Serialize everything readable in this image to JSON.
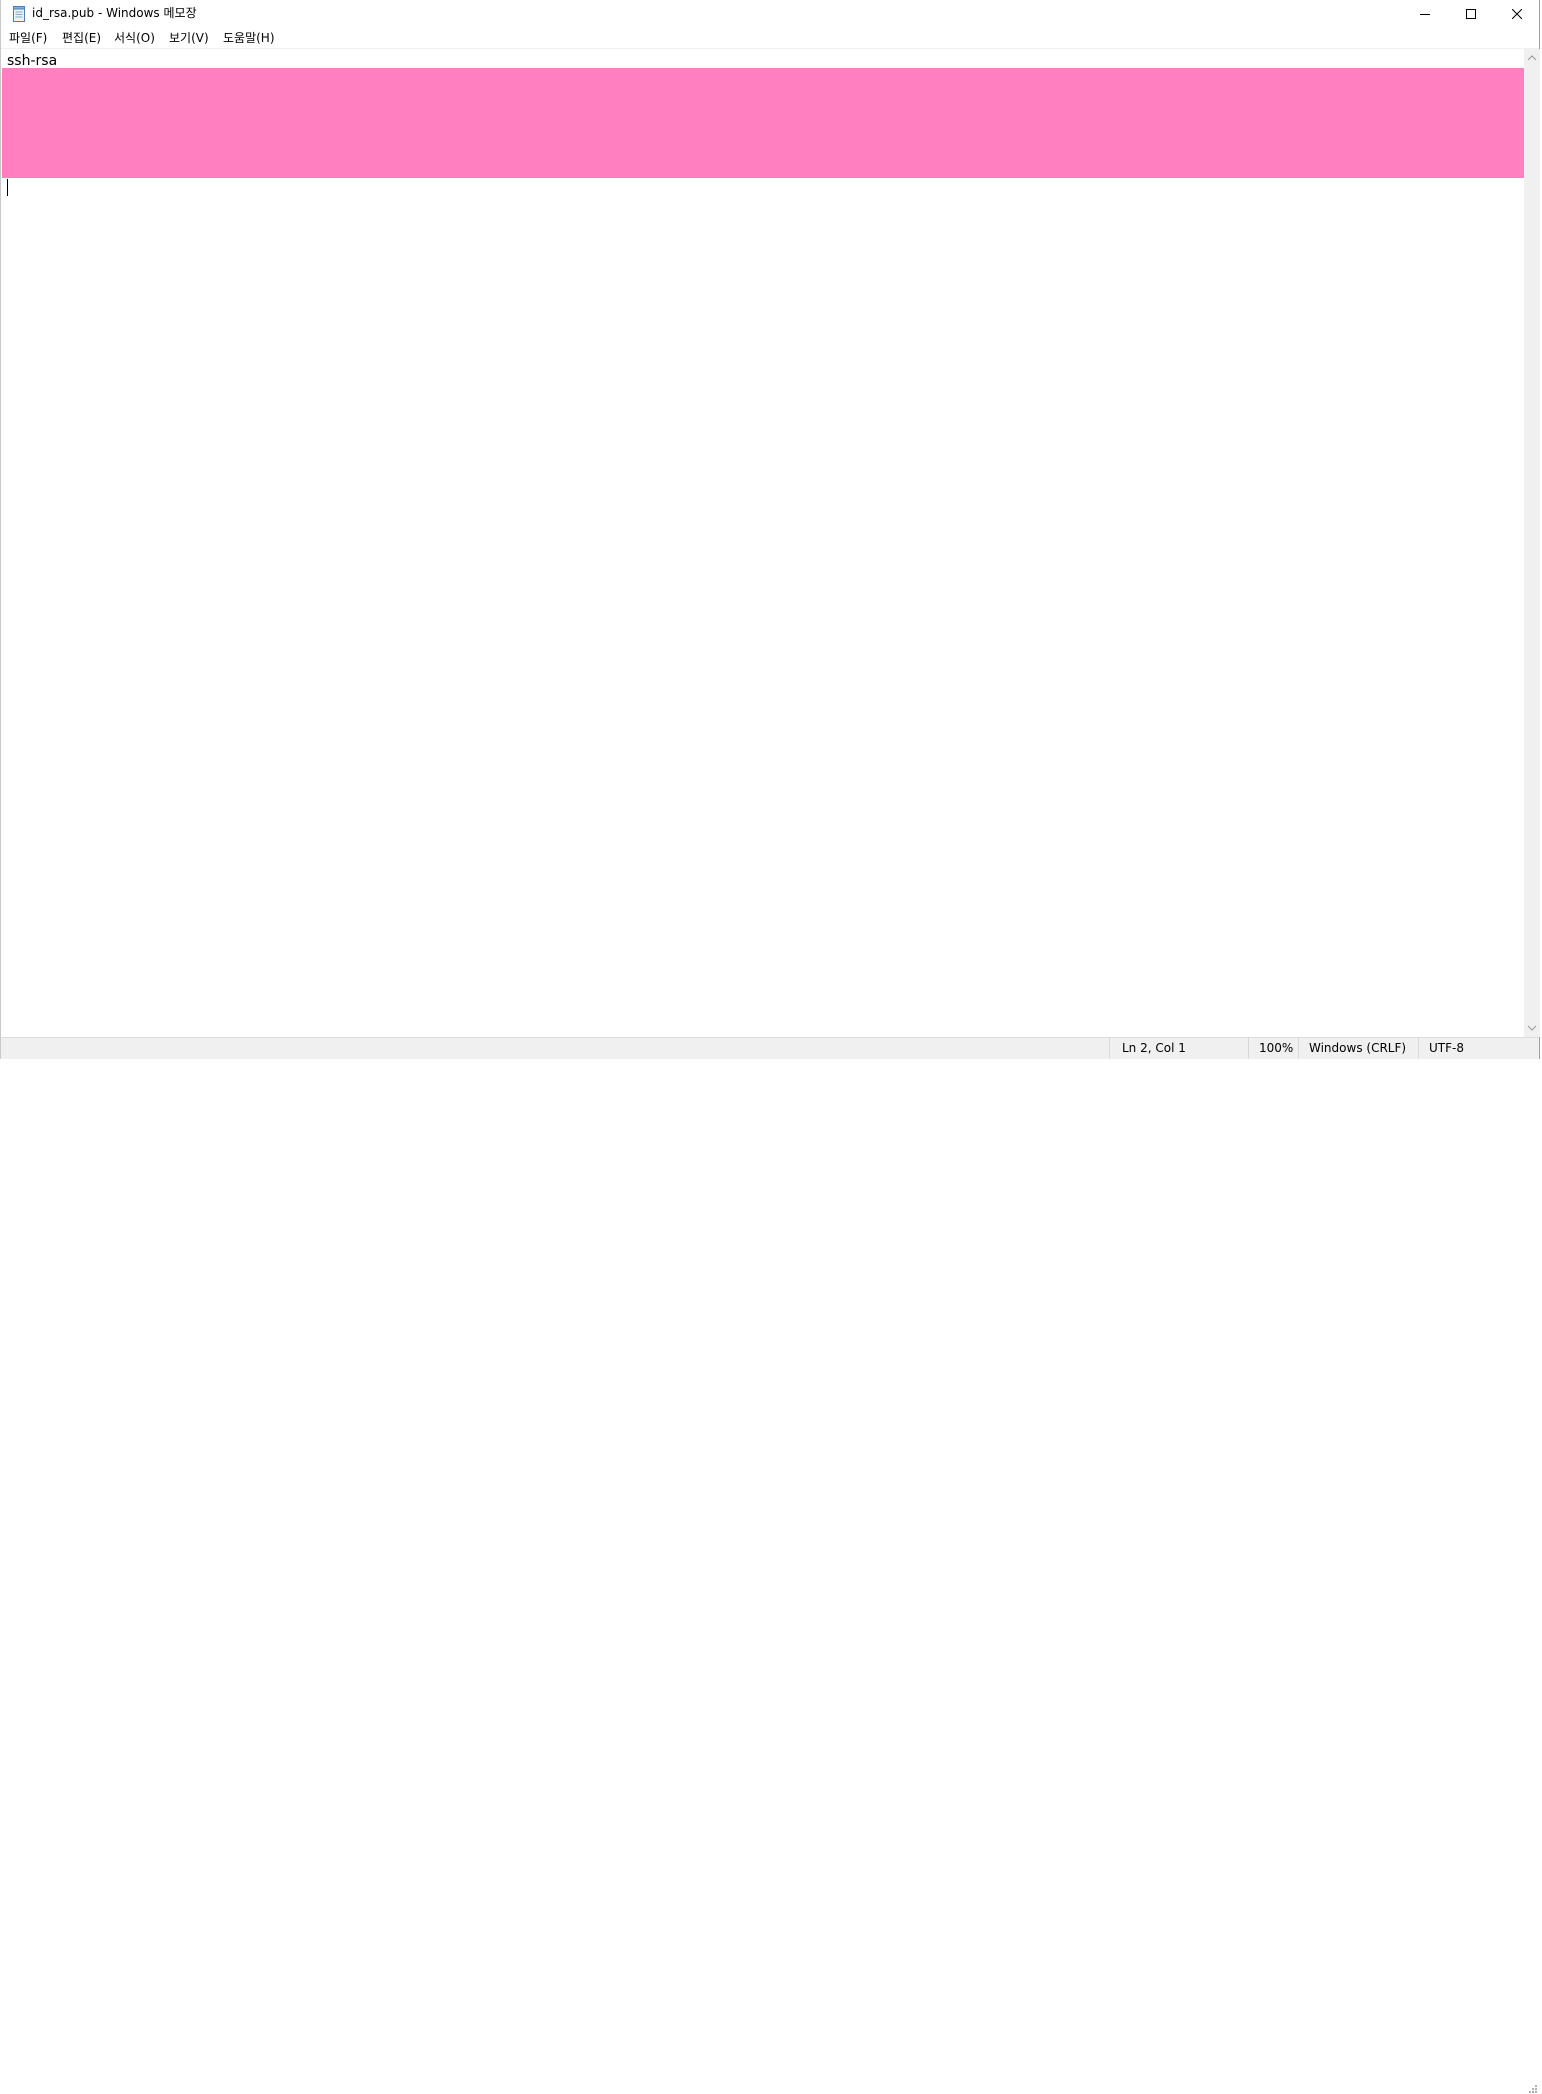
{
  "window": {
    "title": "id_rsa.pub - Windows 메모장",
    "icon": "notepad-icon"
  },
  "menu": {
    "items": [
      {
        "label": "파일(F)"
      },
      {
        "label": "편집(E)"
      },
      {
        "label": "서식(O)"
      },
      {
        "label": "보기(V)"
      },
      {
        "label": "도움말(H)"
      }
    ]
  },
  "editor": {
    "line1": "ssh-rsa",
    "redaction_color": "#ff80c0"
  },
  "status": {
    "position": "Ln 2, Col 1",
    "zoom": "100%",
    "line_ending": "Windows (CRLF)",
    "encoding": "UTF-8"
  }
}
